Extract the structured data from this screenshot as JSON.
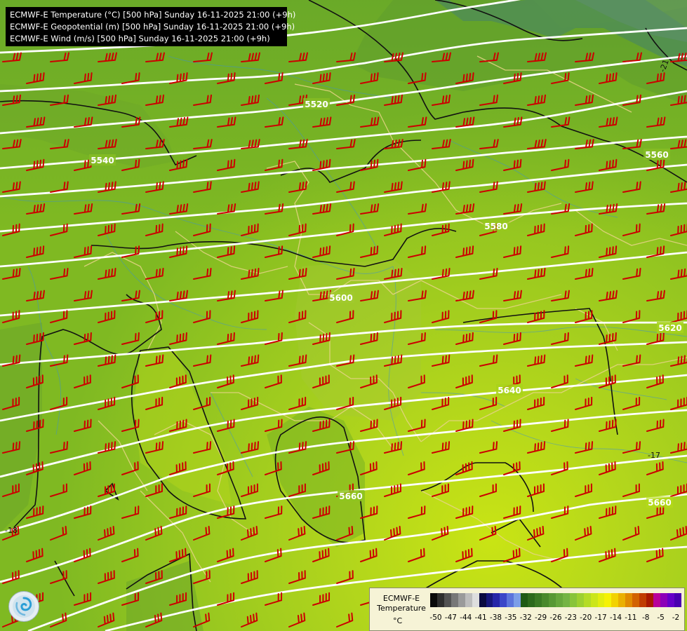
{
  "header": {
    "lines": [
      "ECMWF-E Temperature (°C) [500 hPa] Sunday 16-11-2025 21:00 (+9h)",
      "ECMWF-E Geopotential (m) [500 hPa] Sunday 16-11-2025 21:00 (+9h)",
      "ECMWF-E Wind (m/s) [500 hPa] Sunday 16-11-2025 21:00 (+9h)"
    ]
  },
  "legend": {
    "model": "ECMWF-E",
    "variable": "Temperature",
    "unit": "°C",
    "ticks": [
      "-50",
      "-47",
      "-44",
      "-41",
      "-38",
      "-35",
      "-32",
      "-29",
      "-26",
      "-23",
      "-20",
      "-17",
      "-14",
      "-11",
      "-8",
      "-5",
      "-2"
    ],
    "colors": [
      "#0a0a0a",
      "#2e2e2e",
      "#525252",
      "#777777",
      "#9a9a9a",
      "#bdbdbd",
      "#dedede",
      "#0b0b40",
      "#17177a",
      "#2626a8",
      "#3a46c8",
      "#5b74dc",
      "#7c9ee8",
      "#1e5a14",
      "#2c6a1c",
      "#3a7a24",
      "#49892c",
      "#579834",
      "#66a73c",
      "#74b444",
      "#88c43a",
      "#9dd030",
      "#b4dc26",
      "#cbe61a",
      "#e2ee10",
      "#f5f206",
      "#f2d200",
      "#eab000",
      "#e08a00",
      "#d26200",
      "#c03c00",
      "#a81800",
      "#b8009a",
      "#8c00b8",
      "#6600c8",
      "#4a00b0"
    ]
  },
  "isohypse_labels": [
    "5520",
    "5540",
    "5560",
    "5580",
    "5600",
    "5620",
    "5640",
    "5660",
    "5660"
  ],
  "isotherm_labels": [
    "-17",
    "-18",
    "-21"
  ],
  "colors": {
    "isohypse": "#ffffff",
    "isotherm": "#111111",
    "wind_barb": "#cc0000",
    "border": "#e8d488"
  },
  "logo_icon": "ecmwf-swirl-logo"
}
